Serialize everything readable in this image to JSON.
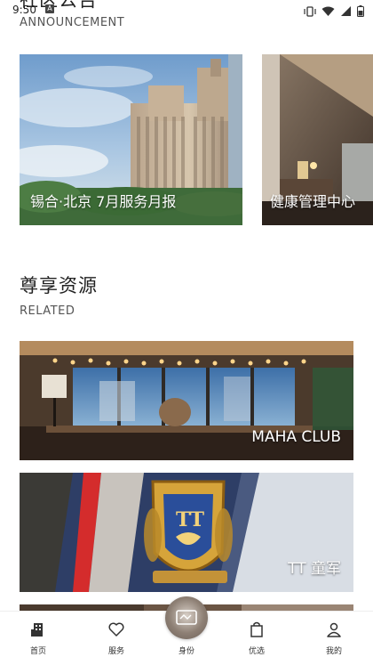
{
  "status": {
    "time": "9:50",
    "badge": "A"
  },
  "announcement": {
    "title": "社区公告",
    "subtitle": "ANNOUNCEMENT",
    "cards": [
      {
        "label": "锡合·北京 7月服务月报"
      },
      {
        "label": "健康管理中心"
      }
    ]
  },
  "related": {
    "title": "尊享资源",
    "subtitle": "RELATED",
    "cards": [
      {
        "label": "MAHA CLUB"
      },
      {
        "label": "TT 童军"
      },
      {
        "label": ""
      }
    ]
  },
  "nav": {
    "items": [
      {
        "label": "首页",
        "icon": "building-icon"
      },
      {
        "label": "服务",
        "icon": "heart-icon"
      },
      {
        "label": "身份",
        "icon": "id-card-icon"
      },
      {
        "label": "优选",
        "icon": "shopping-bag-icon"
      },
      {
        "label": "我的",
        "icon": "person-icon"
      }
    ]
  },
  "colors": {
    "background": "#ffffff",
    "text": "#222222",
    "subtext": "#555555"
  }
}
